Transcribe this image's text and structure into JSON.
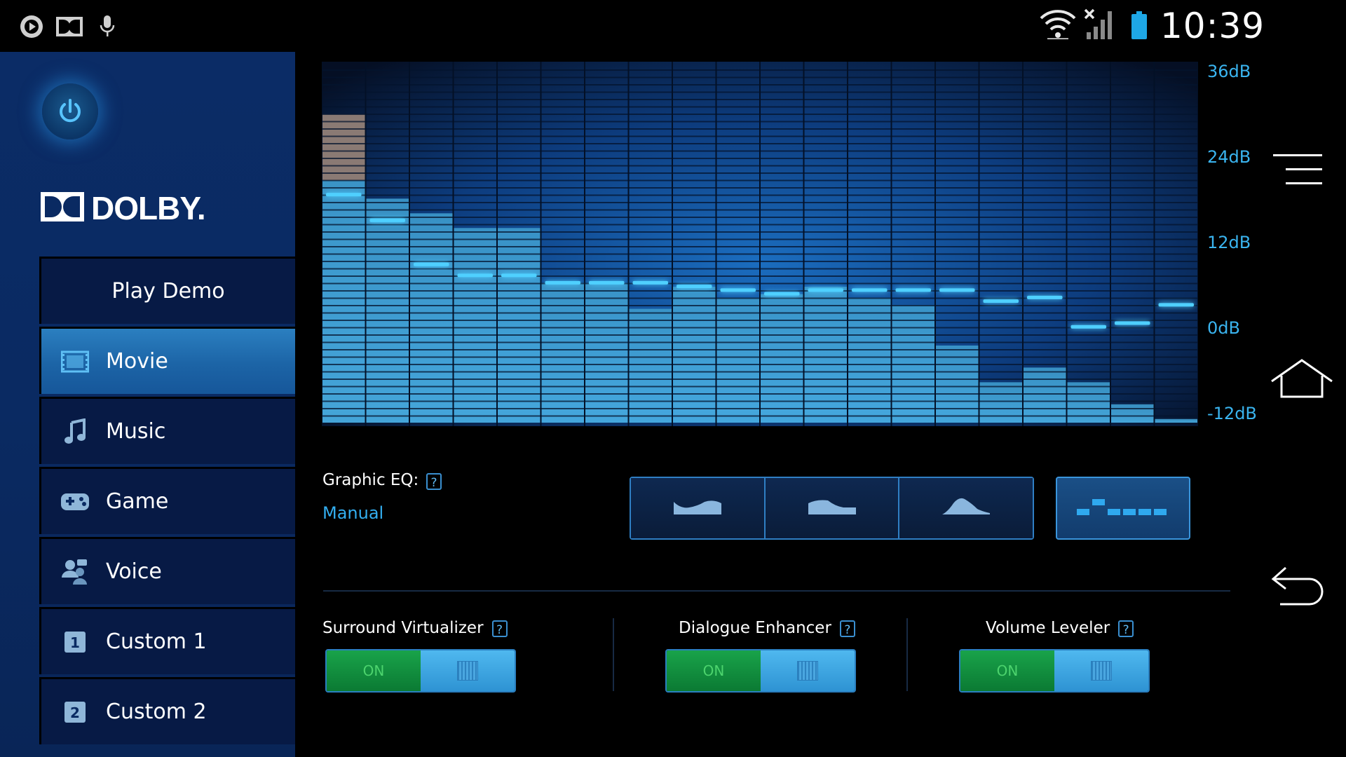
{
  "status_bar": {
    "time": "10:39",
    "icons": [
      "play-circle-icon",
      "dolby-icon",
      "microphone-icon",
      "wifi-icon",
      "no-signal-icon",
      "battery-icon"
    ]
  },
  "sidebar": {
    "power_icon": "power-icon",
    "logo_text": "DOLBY.",
    "play_demo_label": "Play Demo",
    "items": [
      {
        "label": "Movie",
        "icon": "movie-icon",
        "active": true
      },
      {
        "label": "Music",
        "icon": "music-note-icon",
        "active": false
      },
      {
        "label": "Game",
        "icon": "gamepad-icon",
        "active": false
      },
      {
        "label": "Voice",
        "icon": "voice-icon",
        "active": false
      },
      {
        "label": "Custom 1",
        "icon": "custom-1-icon",
        "active": false
      },
      {
        "label": "Custom 2",
        "icon": "custom-2-icon",
        "active": false
      }
    ]
  },
  "eq": {
    "db_labels": [
      "36dB",
      "24dB",
      "12dB",
      "0dB",
      "-12dB"
    ],
    "db_max": 36,
    "db_min": -12,
    "band_levels_db": [
      19,
      15.5,
      9.5,
      8,
      8,
      7,
      7,
      7,
      6.5,
      6,
      5.5,
      6,
      6,
      6,
      6,
      4.5,
      5,
      1,
      1.5,
      4
    ],
    "band_fill_db": [
      30,
      18.5,
      16.5,
      14.5,
      14.5,
      7,
      7,
      3.5,
      6.5,
      5,
      5.5,
      6.5,
      5,
      4,
      -1.5,
      -6.5,
      -4.5,
      -6.5,
      -9.5,
      -11.5
    ],
    "highlight_fill_db": [
      30,
      21
    ]
  },
  "graphic_eq": {
    "label": "Graphic EQ:",
    "help": "?",
    "value": "Manual",
    "presets": [
      "open-preset-icon",
      "rich-preset-icon",
      "focused-preset-icon"
    ],
    "manual_icon": "manual-eq-icon"
  },
  "features": [
    {
      "label": "Surround Virtualizer",
      "help": "?",
      "state": "ON"
    },
    {
      "label": "Dialogue Enhancer",
      "help": "?",
      "state": "ON"
    },
    {
      "label": "Volume Leveler",
      "help": "?",
      "state": "ON"
    }
  ],
  "nav": {
    "icons": [
      "menu-icon",
      "home-icon",
      "back-icon"
    ]
  },
  "colors": {
    "accent": "#33aef0",
    "toggle_on": "#19a34a",
    "sidebar_active": "#2276b8"
  }
}
